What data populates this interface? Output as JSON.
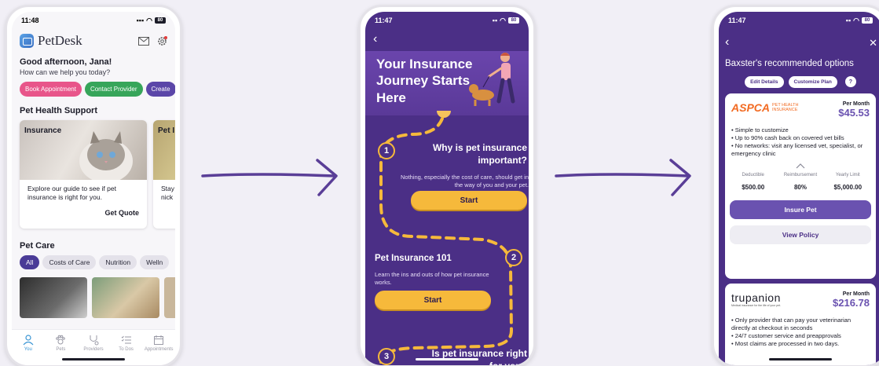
{
  "phone1": {
    "time": "11:48",
    "battery": "80",
    "brand": "PetDesk",
    "greeting": "Good afternoon, Jana!",
    "subgreeting": "How can we help you today?",
    "chips": [
      {
        "label": "Book Appointment",
        "color": "#e8558a"
      },
      {
        "label": "Contact Provider",
        "color": "#37a55a"
      },
      {
        "label": "Create",
        "color": "#5b46a8"
      }
    ],
    "health_title": "Pet Health Support",
    "insurance_label": "Insurance",
    "insurance_text": "Explore our guide to see if pet insurance is right for you.",
    "get_quote": "Get Quote",
    "card2_label": "Pet I",
    "card2_text": "Stay nick",
    "pet_care_title": "Pet Care",
    "filters": [
      "All",
      "Costs of Care",
      "Nutrition",
      "Welln"
    ],
    "tabs": [
      "You",
      "Pets",
      "Providers",
      "To Dos",
      "Appointments"
    ]
  },
  "phone2": {
    "time": "11:47",
    "battery": "80",
    "title": "Your Insurance Journey Starts Here",
    "step1_num": "1",
    "step1_q": "Why is pet insurance important?",
    "step1_desc": "Nothing, especially the cost of care, should get in the way of you and your pet.",
    "start1": "Start",
    "step2_num": "2",
    "step2_title": "Pet Insurance 101",
    "step2_desc": "Learn the ins and outs of how pet insurance works.",
    "start2": "Start",
    "step3_num": "3",
    "step3_q": "Is pet insurance right for you?"
  },
  "phone3": {
    "time": "11:47",
    "battery": "80",
    "heading": "Baxster's recommended options",
    "edit_details": "Edit Details",
    "customize_plan": "Customize Plan",
    "help": "?",
    "plan1": {
      "logo_main": "ASPCA",
      "logo_sub1": "PET HEALTH",
      "logo_sub2": "INSURANCE",
      "price_label": "Per Month",
      "price": "$45.53",
      "bullets": [
        "• Simple to customize",
        "• Up to 90% cash back on covered vet bills",
        "• No networks: visit any licensed vet, specialist, or emergency clinic"
      ],
      "terms": [
        {
          "label": "Deductible",
          "value": "$500.00"
        },
        {
          "label": "Reimbursement",
          "value": "80%"
        },
        {
          "label": "Yearly Limit",
          "value": "$5,000.00"
        }
      ],
      "insure": "Insure Pet",
      "view": "View Policy"
    },
    "plan2": {
      "logo_main": "trupanion",
      "logo_tag": "Medical insurance for the life of your pet.",
      "price_label": "Per Month",
      "price": "$216.78",
      "bullets": [
        "• Only provider that can pay your veterinarian directly at checkout in seconds",
        "• 24/7 customer service and preapprovals",
        "• Most claims are processed in two days."
      ]
    }
  }
}
